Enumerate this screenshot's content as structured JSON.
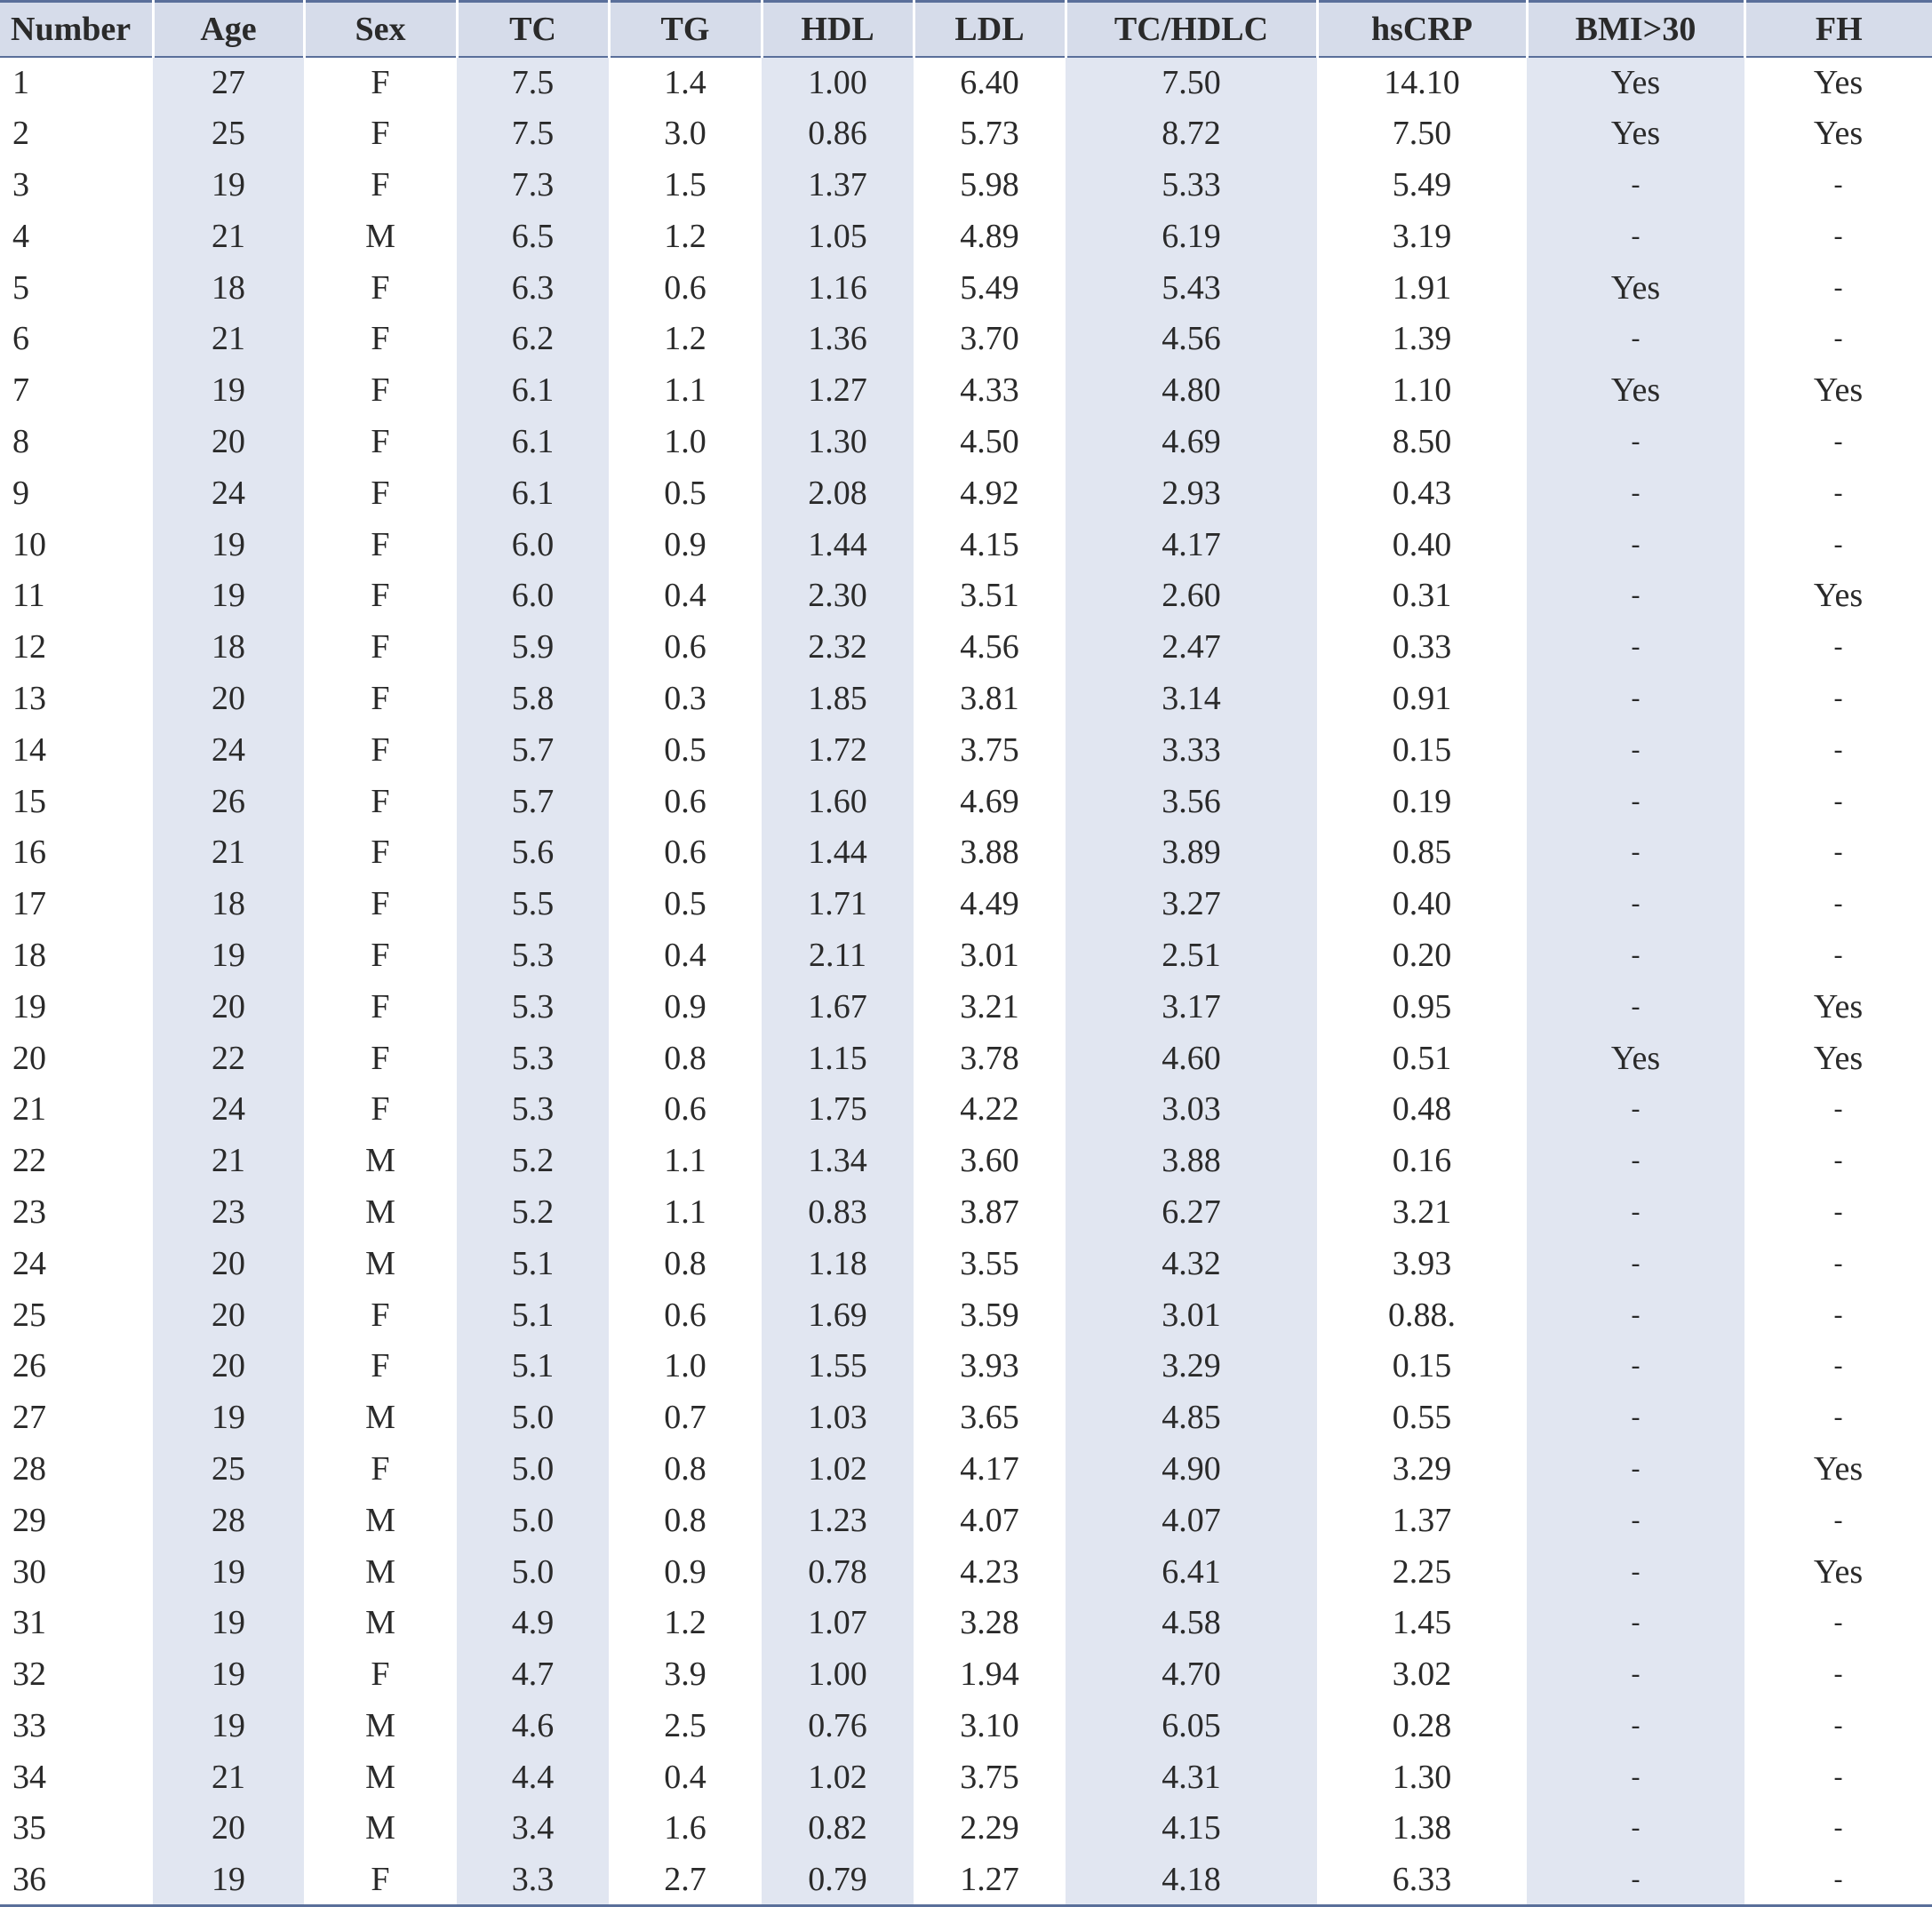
{
  "table": {
    "headers": [
      "Number",
      "Age",
      "Sex",
      "TC",
      "TG",
      "HDL",
      "LDL",
      "TC/HDLC",
      "hsCRP",
      "BMI>30",
      "FH"
    ],
    "rows": [
      [
        "1",
        "27",
        "F",
        "7.5",
        "1.4",
        "1.00",
        "6.40",
        "7.50",
        "14.10",
        "Yes",
        "Yes"
      ],
      [
        "2",
        "25",
        "F",
        "7.5",
        "3.0",
        "0.86",
        "5.73",
        "8.72",
        "7.50",
        "Yes",
        "Yes"
      ],
      [
        "3",
        "19",
        "F",
        "7.3",
        "1.5",
        "1.37",
        "5.98",
        "5.33",
        "5.49",
        "-",
        "-"
      ],
      [
        "4",
        "21",
        "M",
        "6.5",
        "1.2",
        "1.05",
        "4.89",
        "6.19",
        "3.19",
        "-",
        "-"
      ],
      [
        "5",
        "18",
        "F",
        "6.3",
        "0.6",
        "1.16",
        "5.49",
        "5.43",
        "1.91",
        "Yes",
        "-"
      ],
      [
        "6",
        "21",
        "F",
        "6.2",
        "1.2",
        "1.36",
        "3.70",
        "4.56",
        "1.39",
        "-",
        "-"
      ],
      [
        "7",
        "19",
        "F",
        "6.1",
        "1.1",
        "1.27",
        "4.33",
        "4.80",
        "1.10",
        "Yes",
        "Yes"
      ],
      [
        "8",
        "20",
        "F",
        "6.1",
        "1.0",
        "1.30",
        "4.50",
        "4.69",
        "8.50",
        "-",
        "-"
      ],
      [
        "9",
        "24",
        "F",
        "6.1",
        "0.5",
        "2.08",
        "4.92",
        "2.93",
        "0.43",
        "-",
        "-"
      ],
      [
        "10",
        "19",
        "F",
        "6.0",
        "0.9",
        "1.44",
        "4.15",
        "4.17",
        "0.40",
        "-",
        "-"
      ],
      [
        "11",
        "19",
        "F",
        "6.0",
        "0.4",
        "2.30",
        "3.51",
        "2.60",
        "0.31",
        "-",
        "Yes"
      ],
      [
        "12",
        "18",
        "F",
        "5.9",
        "0.6",
        "2.32",
        "4.56",
        "2.47",
        "0.33",
        "-",
        "-"
      ],
      [
        "13",
        "20",
        "F",
        "5.8",
        "0.3",
        "1.85",
        "3.81",
        "3.14",
        "0.91",
        "-",
        "-"
      ],
      [
        "14",
        "24",
        "F",
        "5.7",
        "0.5",
        "1.72",
        "3.75",
        "3.33",
        "0.15",
        "-",
        "-"
      ],
      [
        "15",
        "26",
        "F",
        "5.7",
        "0.6",
        "1.60",
        "4.69",
        "3.56",
        "0.19",
        "-",
        "-"
      ],
      [
        "16",
        "21",
        "F",
        "5.6",
        "0.6",
        "1.44",
        "3.88",
        "3.89",
        "0.85",
        "-",
        "-"
      ],
      [
        "17",
        "18",
        "F",
        "5.5",
        "0.5",
        "1.71",
        "4.49",
        "3.27",
        "0.40",
        "-",
        "-"
      ],
      [
        "18",
        "19",
        "F",
        "5.3",
        "0.4",
        "2.11",
        "3.01",
        "2.51",
        "0.20",
        "-",
        "-"
      ],
      [
        "19",
        "20",
        "F",
        "5.3",
        "0.9",
        "1.67",
        "3.21",
        "3.17",
        "0.95",
        "-",
        "Yes"
      ],
      [
        "20",
        "22",
        "F",
        "5.3",
        "0.8",
        "1.15",
        "3.78",
        "4.60",
        "0.51",
        "Yes",
        "Yes"
      ],
      [
        "21",
        "24",
        "F",
        "5.3",
        "0.6",
        "1.75",
        "4.22",
        "3.03",
        "0.48",
        "-",
        "-"
      ],
      [
        "22",
        "21",
        "M",
        "5.2",
        "1.1",
        "1.34",
        "3.60",
        "3.88",
        "0.16",
        "-",
        "-"
      ],
      [
        "23",
        "23",
        "M",
        "5.2",
        "1.1",
        "0.83",
        "3.87",
        "6.27",
        "3.21",
        "-",
        "-"
      ],
      [
        "24",
        "20",
        "M",
        "5.1",
        "0.8",
        "1.18",
        "3.55",
        "4.32",
        "3.93",
        "-",
        "-"
      ],
      [
        "25",
        "20",
        "F",
        "5.1",
        "0.6",
        "1.69",
        "3.59",
        "3.01",
        "0.88.",
        "-",
        "-"
      ],
      [
        "26",
        "20",
        "F",
        "5.1",
        "1.0",
        "1.55",
        "3.93",
        "3.29",
        "0.15",
        "-",
        "-"
      ],
      [
        "27",
        "19",
        "M",
        "5.0",
        "0.7",
        "1.03",
        "3.65",
        "4.85",
        "0.55",
        "-",
        "-"
      ],
      [
        "28",
        "25",
        "F",
        "5.0",
        "0.8",
        "1.02",
        "4.17",
        "4.90",
        "3.29",
        "-",
        "Yes"
      ],
      [
        "29",
        "28",
        "M",
        "5.0",
        "0.8",
        "1.23",
        "4.07",
        "4.07",
        "1.37",
        "-",
        "-"
      ],
      [
        "30",
        "19",
        "M",
        "5.0",
        "0.9",
        "0.78",
        "4.23",
        "6.41",
        "2.25",
        "-",
        "Yes"
      ],
      [
        "31",
        "19",
        "M",
        "4.9",
        "1.2",
        "1.07",
        "3.28",
        "4.58",
        "1.45",
        "-",
        "-"
      ],
      [
        "32",
        "19",
        "F",
        "4.7",
        "3.9",
        "1.00",
        "1.94",
        "4.70",
        "3.02",
        "-",
        "-"
      ],
      [
        "33",
        "19",
        "M",
        "4.6",
        "2.5",
        "0.76",
        "3.10",
        "6.05",
        "0.28",
        "-",
        "-"
      ],
      [
        "34",
        "21",
        "M",
        "4.4",
        "0.4",
        "1.02",
        "3.75",
        "4.31",
        "1.30",
        "-",
        "-"
      ],
      [
        "35",
        "20",
        "M",
        "3.4",
        "1.6",
        "0.82",
        "2.29",
        "4.15",
        "1.38",
        "-",
        "-"
      ],
      [
        "36",
        "19",
        "F",
        "3.3",
        "2.7",
        "0.79",
        "1.27",
        "4.18",
        "6.33",
        "-",
        "-"
      ]
    ],
    "shaded_columns": [
      1,
      3,
      5,
      7,
      9
    ],
    "colors": {
      "header_bg": "#d6dcea",
      "shade_bg": "#e1e6f1",
      "rule": "#5a6f9a",
      "text": "#2a2a2a"
    }
  }
}
